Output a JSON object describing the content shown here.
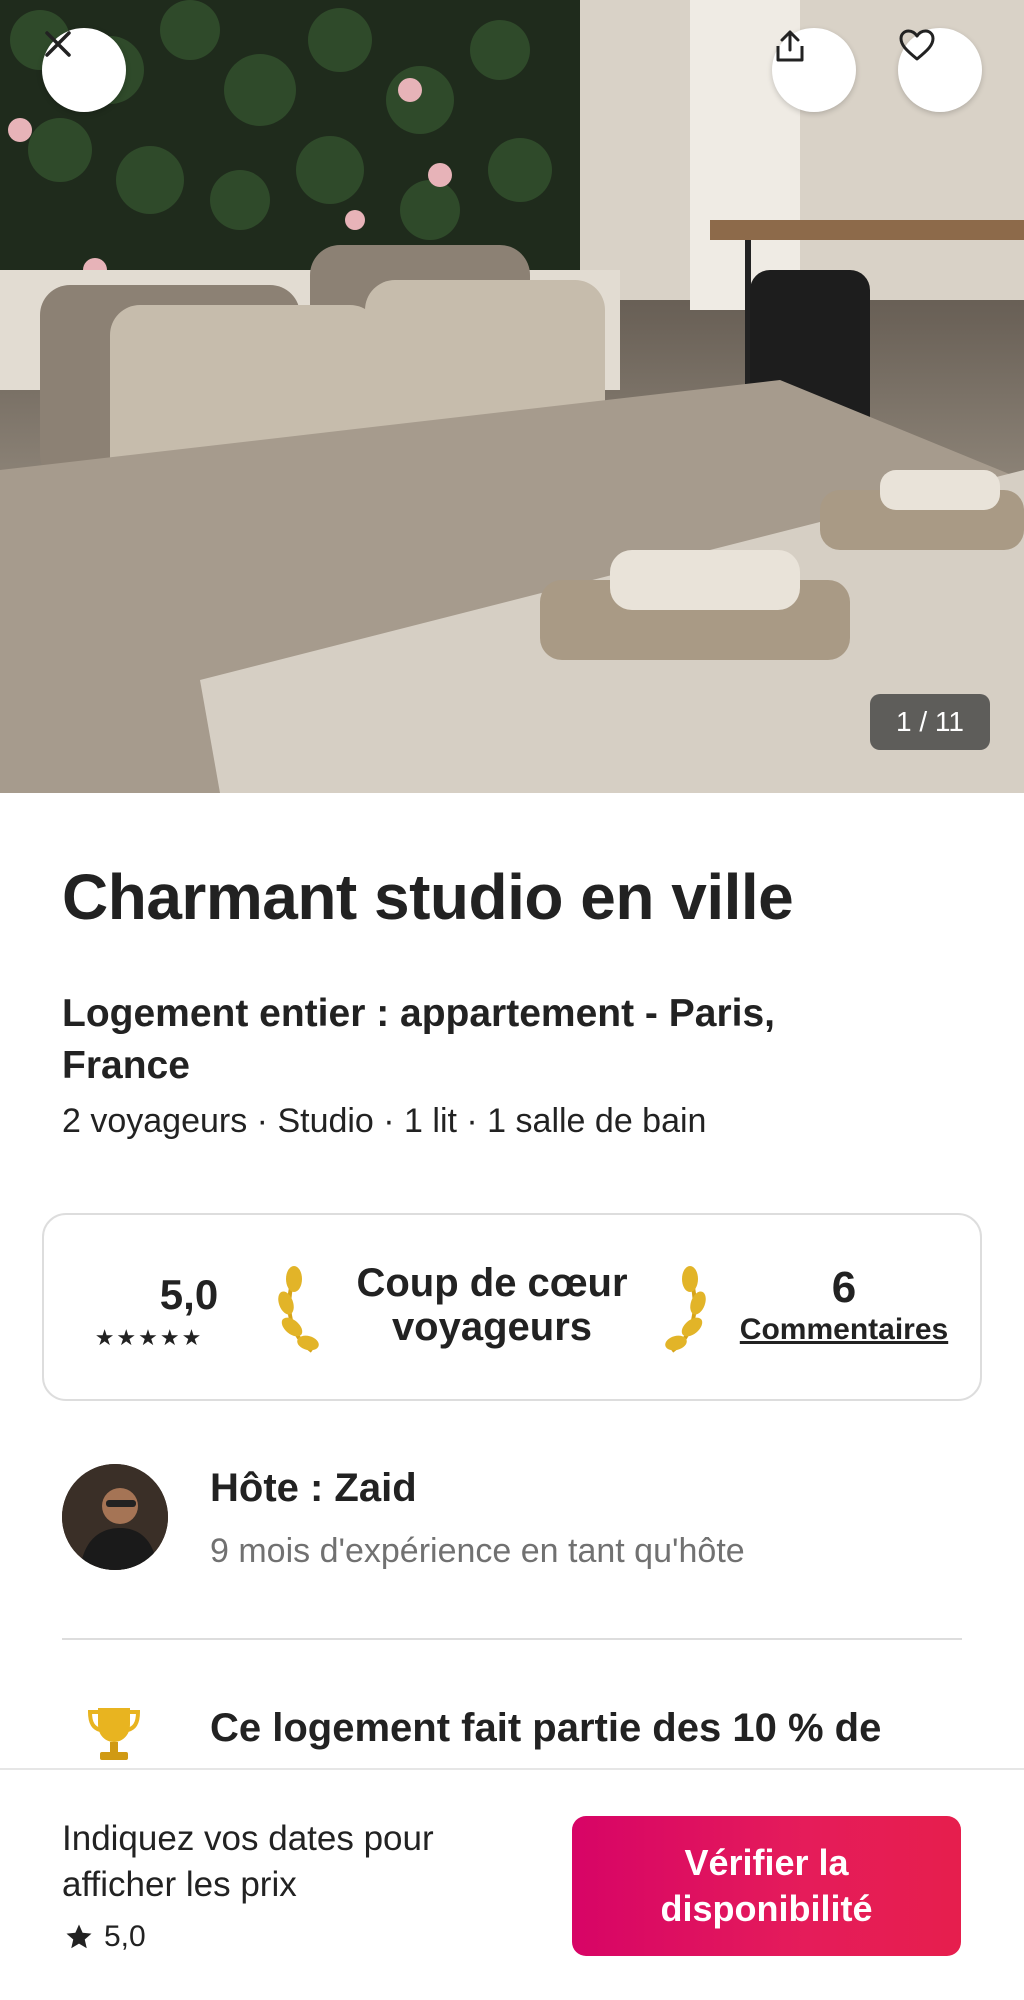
{
  "photo": {
    "counter": "1 / 11",
    "close_icon": "close-icon",
    "share_icon": "share-icon",
    "favorite_icon": "heart-icon"
  },
  "listing": {
    "title": "Charmant studio en ville",
    "subtitle": "Logement entier : appartement - Paris, France",
    "details": "2 voyageurs · Studio · 1 lit · 1 salle de bain"
  },
  "rating_card": {
    "score": "5,0",
    "stars": "★★★★★",
    "badge": "Coup de cœur voyageurs",
    "review_count": "6",
    "reviews_link": "Commentaires"
  },
  "host": {
    "name": "Hôte : Zaid",
    "experience": "9 mois d'expérience en tant qu'hôte"
  },
  "highlight": {
    "icon": "trophy-icon",
    "text": "Ce logement fait partie des 10 % de"
  },
  "bottom_bar": {
    "price_hint": "Indiquez vos dates pour afficher les prix",
    "rating": "5,0",
    "cta_label": "Vérifier la disponibilité"
  },
  "colors": {
    "accent": "#e61e4d",
    "text": "#222222",
    "muted": "#717171",
    "border": "#dddddd"
  }
}
